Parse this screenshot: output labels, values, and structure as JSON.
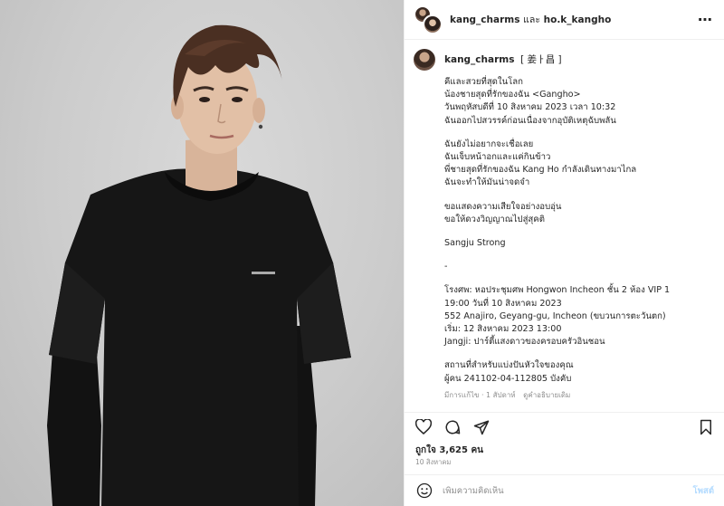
{
  "header": {
    "user1": "kang_charms",
    "conjunction": "และ",
    "user2": "ho.k_kangho",
    "more_icon": "more-horizontal-icon"
  },
  "caption": {
    "username": "kang_charms",
    "tag": "[ 姜ㅏ昌 ]",
    "lines": [
      "คีและสวยที่สุดในโลก",
      "น้องชายสุดที่รักของฉัน <Gangho>",
      "วันพฤหัสบดีที่ 10 สิงหาคม 2023 เวลา 10:32",
      "ฉันออกไปสวรรค์ก่อนเนื่องจากอุบัติเหตุฉับพลัน",
      "",
      "ฉันยังไม่อยากจะเชื่อเลย",
      "ฉันเจ็บหน้าอกและแค่กินข้าว",
      "พี่ชายสุดที่รักของฉัน Kang Ho กำลังเดินทางมาไกล",
      "ฉันจะทำให้มันน่าจดจำ",
      "",
      "ขอแสดงความเสียใจอย่างอบอุ่น",
      "ขอให้ดวงวิญญาณไปสู่สุคติ",
      "",
      "Sangju Strong",
      "",
      "-",
      "",
      "โรงศพ: หอประชุมศพ Hongwon Incheon ชั้น 2 ห้อง VIP 1",
      "19:00 วันที่ 10 สิงหาคม 2023",
      "552 Anajiro, Geyang-gu, Incheon (ขบวนการตะวันตก)",
      "เริ่ม: 12 สิงหาคม 2023 13:00",
      "Jangji: ปาร์ตี้แสงดาวของครอบครัวอินชอน",
      "",
      "สถานที่สำหรับแบ่งปันหัวใจของคุณ",
      "ผู้คน 241102-04-112805 บังคับ"
    ],
    "meta_edited": "มีการแก้ไข · 1 สัปดาห์",
    "meta_translate": "ดูคำอธิบายเดิม"
  },
  "actions": {
    "like_icon": "heart-icon",
    "comment_icon": "comment-icon",
    "share_icon": "send-icon",
    "save_icon": "bookmark-icon"
  },
  "likes_text": "ถูกใจ 3,625 คน",
  "date_text": "10 สิงหาคม",
  "comment": {
    "emoji_icon": "smiley-icon",
    "placeholder": "เพิ่มความคิดเห็น",
    "post_label": "โพสต์"
  },
  "colors": {
    "post_button": "#b3dbff",
    "secondary_text": "#8e8e8e",
    "border": "#efefef"
  }
}
